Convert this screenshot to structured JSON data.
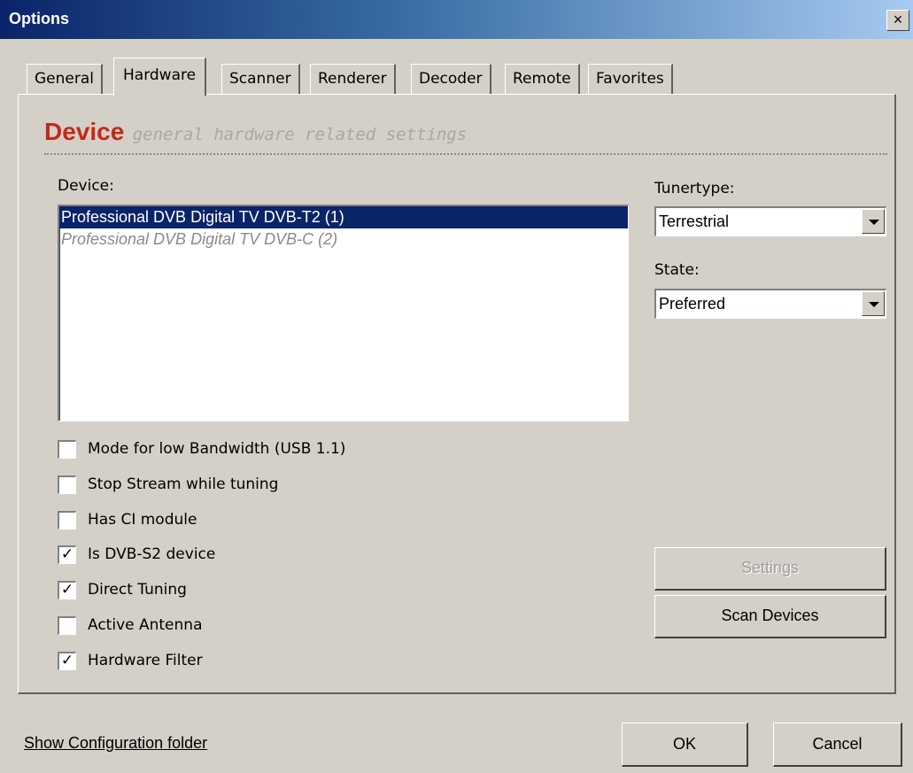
{
  "window": {
    "title": "Options",
    "close_glyph": "×"
  },
  "tabs": [
    {
      "label": "General"
    },
    {
      "label": "Hardware"
    },
    {
      "label": "Scanner"
    },
    {
      "label": "Renderer"
    },
    {
      "label": "Decoder"
    },
    {
      "label": "Remote"
    },
    {
      "label": "Favorites"
    }
  ],
  "section": {
    "title": "Device",
    "subtitle": "general hardware related settings"
  },
  "device_list": {
    "label": "Device:",
    "items": [
      {
        "text": "Professional DVB Digital TV DVB-T2 (1)",
        "selected": true
      },
      {
        "text": "Professional DVB Digital TV DVB-C (2)",
        "selected": false
      }
    ]
  },
  "tunertype": {
    "label": "Tunertype:",
    "value": "Terrestrial"
  },
  "state": {
    "label": "State:",
    "value": "Preferred"
  },
  "options": [
    {
      "label": "Mode for low Bandwidth (USB 1.1)",
      "checked": false,
      "mark": ""
    },
    {
      "label": "Stop Stream while tuning",
      "checked": false,
      "mark": ""
    },
    {
      "label": "Has CI module",
      "checked": false,
      "mark": ""
    },
    {
      "label": "Is DVB-S2 device",
      "checked": true,
      "mark": "✓"
    },
    {
      "label": "Direct Tuning",
      "checked": true,
      "mark": "✓"
    },
    {
      "label": "Active Antenna",
      "checked": false,
      "mark": ""
    },
    {
      "label": "Hardware Filter",
      "checked": true,
      "mark": "✓"
    }
  ],
  "buttons": {
    "settings": "Settings",
    "scan_devices": "Scan Devices",
    "ok": "OK",
    "cancel": "Cancel"
  },
  "footer": {
    "link": "Show Configuration folder"
  },
  "colors": {
    "title_bar": "#0a246a",
    "accent": "#c4281a",
    "selection": "#0a246a"
  }
}
